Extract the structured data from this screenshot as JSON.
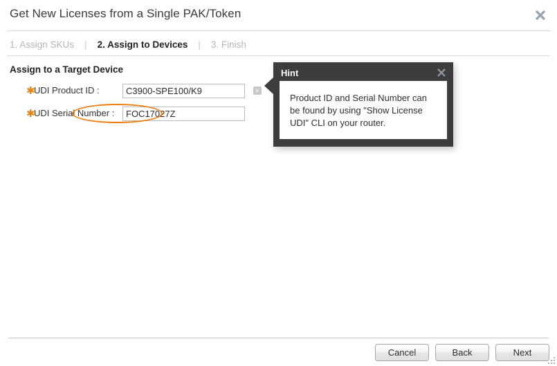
{
  "dialog": {
    "title": "Get New Licenses from a Single PAK/Token",
    "close_icon": "close-icon"
  },
  "steps": {
    "separator": "|",
    "items": [
      {
        "label": "1. Assign SKUs",
        "active": false
      },
      {
        "label": "2. Assign to Devices",
        "active": true
      },
      {
        "label": "3. Finish",
        "active": false
      }
    ]
  },
  "main": {
    "section_title": "Assign to a Target Device",
    "required_marker": "✱",
    "fields": [
      {
        "label": "UDI Product ID :",
        "value": "C3900-SPE100/K9",
        "placeholder": "",
        "required": true
      },
      {
        "label": "UDI Serial Number :",
        "value": "FOC17027Z",
        "placeholder": "",
        "required": true
      }
    ],
    "hint_toggle_icon": "play-triangle-icon"
  },
  "hint": {
    "title": "Hint",
    "close_icon": "close-icon",
    "text": "Product ID and Serial Number can be found by using \"Show License UDI\" CLI on your router.",
    "annotation_highlight": "\"Show License UDI\"",
    "annotation_color": "#f07d0a"
  },
  "footer": {
    "buttons": [
      {
        "label": "Cancel",
        "name": "cancel-button"
      },
      {
        "label": "Back",
        "name": "back-button"
      },
      {
        "label": "Next",
        "name": "next-button"
      }
    ]
  },
  "colors": {
    "accent_orange": "#e8820c",
    "hint_background": "#3d3d3d",
    "close_icon": "#93a5b3",
    "step_inactive": "#b6b6b6",
    "step_active": "#232323"
  }
}
